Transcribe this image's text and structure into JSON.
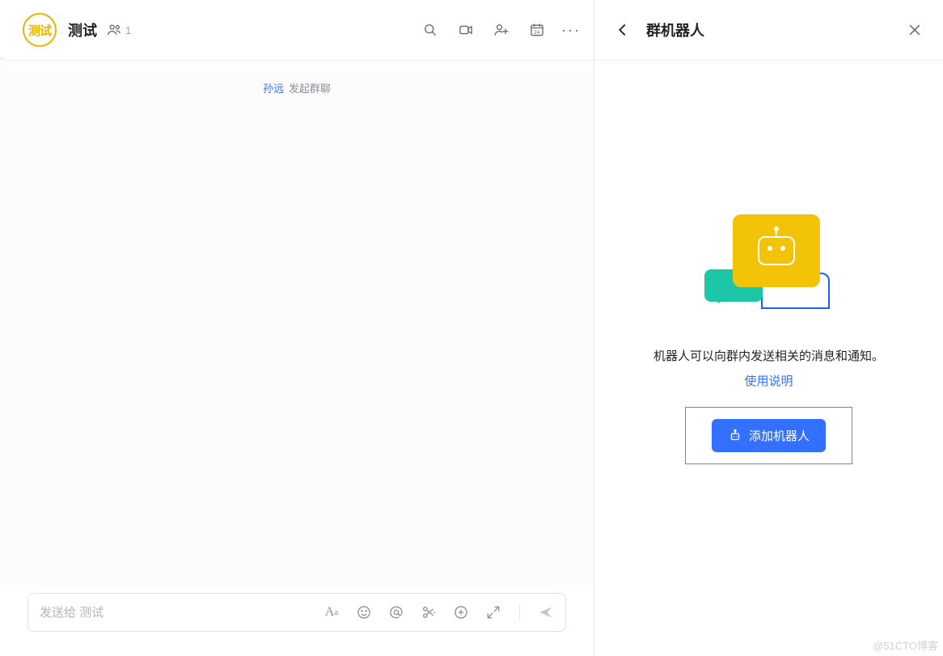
{
  "chat": {
    "avatar_text": "测试",
    "title": "测试",
    "member_count": "1",
    "system_message": {
      "user": "孙远",
      "action": "发起群聊"
    },
    "composer_placeholder": "发送给 测试"
  },
  "panel": {
    "title": "群机器人",
    "description": "机器人可以向群内发送相关的消息和通知。",
    "help_link": "使用说明",
    "add_button": "添加机器人"
  },
  "watermark": "@51CTO博客"
}
